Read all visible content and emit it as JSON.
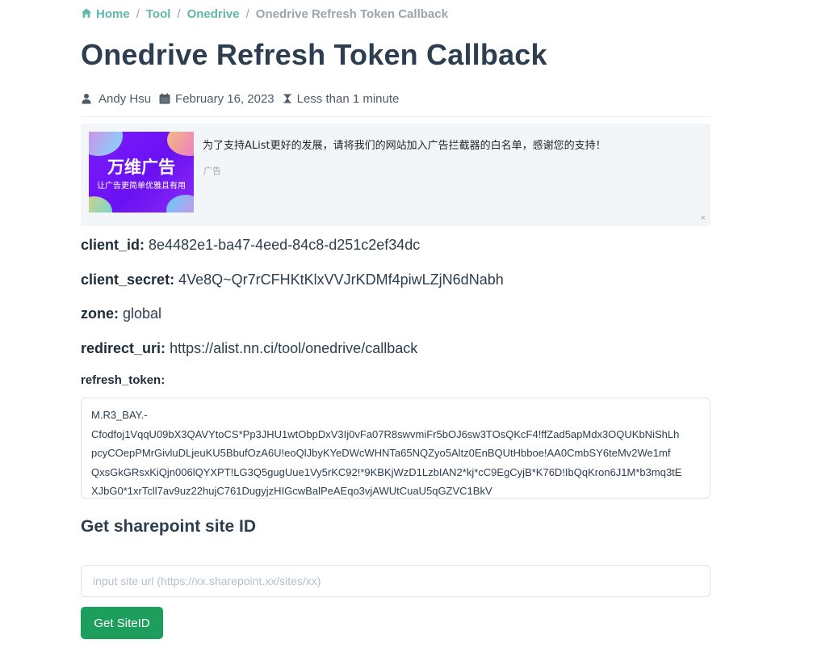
{
  "breadcrumb": {
    "items": [
      {
        "label": "Home",
        "icon": "home-icon"
      },
      {
        "label": "Tool"
      },
      {
        "label": "Onedrive"
      }
    ],
    "current": "Onedrive Refresh Token Callback",
    "separator": "/"
  },
  "page": {
    "title": "Onedrive Refresh Token Callback"
  },
  "meta": {
    "author": "Andy Hsu",
    "date": "February 16, 2023",
    "reading_time": "Less than 1 minute"
  },
  "ad": {
    "brand": "万维广告",
    "slogan": "让广告更简单优雅且有用",
    "text": "为了支持AList更好的发展，请将我们的网站加入广告拦截器的白名单，感谢您的支持！",
    "label": "广告",
    "close": "×"
  },
  "fields": {
    "client_id": {
      "key": "client_id:",
      "value": "8e4482e1-ba47-4eed-84c8-d251c2ef34dc"
    },
    "client_secret": {
      "key": "client_secret:",
      "value": "4Ve8Q~Qr7rCFHKtKlxVVJrKDMf4piwLZjN6dNabh"
    },
    "zone": {
      "key": "zone:",
      "value": "global"
    },
    "redirect_uri": {
      "key": "redirect_uri:",
      "value": "https://alist.nn.ci/tool/onedrive/callback"
    }
  },
  "refresh_token": {
    "label": "refresh_token:",
    "value": "M.R3_BAY.-Cfodfoj1VqqU09bX3QAVYtoCS*Pp3JHU1wtObpDxV3Ij0vFa07R8swvmiFr5bOJ6sw3TOsQKcF4!ffZad5apMdx3OQUKbNiShLhpcyCOepPMrGivluDLjeuKU5BbufOzA6U!eoQlJbyKYeDWcWHNTa65NQZyo5Altz0EnBQUtHbboe!AA0CmbSY6teMv2We1mfQxsGkGRsxKiQjn006lQYXPT!LG3Q5gugUue1Vy5rKC92!*9KBKjWzD1LzbIAN2*kj*cC9EgCyjB*K76D!IbQqKron6J1M*b3mq3tEXJbG0*1xrTcll7av9uz22hujC761DugyjzHIGcwBalPeAEqo3vjAWUtCuaU5qGZVC1BkV",
    "lines": [
      "M.R3_BAY.-",
      "Cfodfoj1VqqU09bX3QAVYtoCS*Pp3JHU1wtObpDxV3Ij0vFa07R8swvmiFr5bOJ6sw3TOsQKcF4!ffZad5apMdx3OQUKbNiShLh",
      "pcyCOepPMrGivluDLjeuKU5BbufOzA6U!eoQlJbyKYeDWcWHNTa65NQZyo5Altz0EnBQUtHbboe!AA0CmbSY6teMv2We1mf",
      "QxsGkGRsxKiQjn006lQYXPT!LG3Q5gugUue1Vy5rKC92!*9KBKjWzD1LzbIAN2*kj*cC9EgCyjB*K76D!IbQqKron6J1M*b3mq3tE",
      "XJbG0*1xrTcll7av9uz22hujC761DugyjzHIGcwBalPeAEqo3vjAWUtCuaU5qGZVC1BkV"
    ]
  },
  "sharepoint": {
    "title": "Get sharepoint site ID",
    "input_placeholder": "input site url (https://xx.sharepoint.xx/sites/xx)",
    "input_value": "",
    "button_label": "Get SiteID"
  },
  "colors": {
    "accent": "#5fb8a8",
    "button": "#1d9e5c",
    "text": "#2c3e50",
    "muted": "#9aa4ad"
  }
}
